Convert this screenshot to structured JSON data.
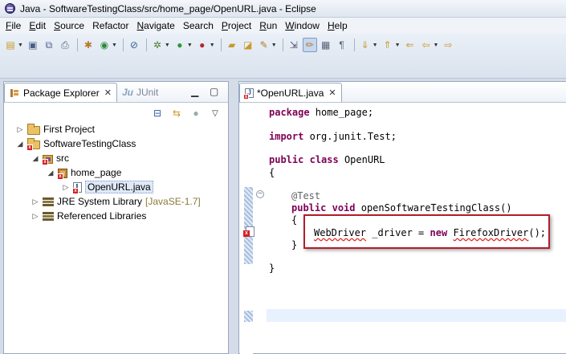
{
  "window": {
    "title": "Java - SoftwareTestingClass/src/home_page/OpenURL.java - Eclipse"
  },
  "menu": [
    {
      "key": "F",
      "rest": "ile"
    },
    {
      "key": "E",
      "rest": "dit"
    },
    {
      "key": "S",
      "rest": "ource"
    },
    {
      "key": "",
      "rest": "Refactor"
    },
    {
      "key": "N",
      "rest": "avigate"
    },
    {
      "key": "",
      "rest": "Search"
    },
    {
      "key": "P",
      "rest": "roject"
    },
    {
      "key": "R",
      "rest": "un"
    },
    {
      "key": "W",
      "rest": "indow"
    },
    {
      "key": "H",
      "rest": "elp"
    }
  ],
  "explorer": {
    "tab_active": "Package Explorer",
    "tab_inactive": "JUnit",
    "tree": [
      {
        "label": "First Project",
        "icon": "project-folder-icon"
      },
      {
        "label": "SoftwareTestingClass",
        "icon": "project-folder-error-icon"
      },
      {
        "label": "src",
        "icon": "source-folder-icon"
      },
      {
        "label": "home_page",
        "icon": "package-icon"
      },
      {
        "label": "OpenURL.java",
        "icon": "java-file-icon"
      },
      {
        "label": "JRE System Library",
        "decoration": "[JavaSE-1.7]",
        "icon": "library-icon"
      },
      {
        "label": "Referenced Libraries",
        "icon": "library-icon"
      }
    ]
  },
  "editor": {
    "tab_label": "*OpenURL.java",
    "code": {
      "package_kw": "package",
      "package_name": " home_page;",
      "import_kw": "import",
      "import_name": " org.junit.Test;",
      "public_kw": "public",
      "class_kw": "class",
      "class_name": " OpenURL",
      "open_brace": "{",
      "annotation": "@Test",
      "void_kw": "void",
      "method_name": " openSoftwareTestingClass()",
      "method_open": "{",
      "webdriver_type": "WebDriver",
      "driver_var": " _driver = ",
      "new_kw": "new",
      "firefox_class": "FirefoxDriver",
      "call_end": "();",
      "method_close": "}",
      "class_close": "}"
    }
  }
}
